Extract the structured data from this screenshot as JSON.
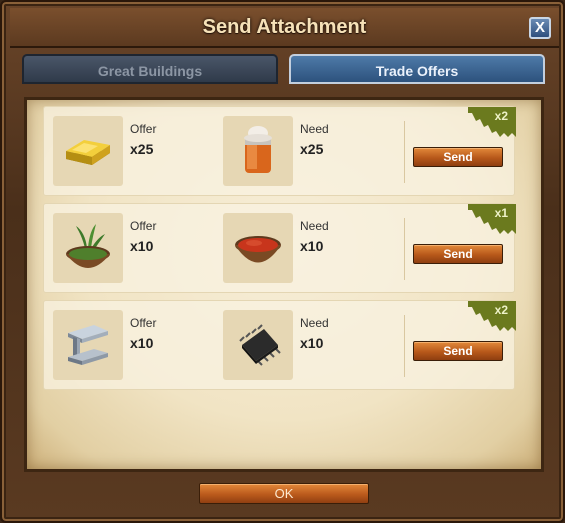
{
  "window": {
    "title": "Send Attachment",
    "close_label": "X"
  },
  "tabs": [
    {
      "label": "Great Buildings",
      "active": false
    },
    {
      "label": "Trade Offers",
      "active": true
    }
  ],
  "offers": [
    {
      "offer_label": "Offer",
      "offer_amount": "x25",
      "offer_icon": "gold-bar-icon",
      "need_label": "Need",
      "need_amount": "x25",
      "need_icon": "jar-preserves-icon",
      "badge": "x2",
      "send_label": "Send"
    },
    {
      "offer_label": "Offer",
      "offer_amount": "x10",
      "offer_icon": "herb-bowl-icon",
      "need_label": "Need",
      "need_amount": "x10",
      "need_icon": "dye-bowl-icon",
      "badge": "x1",
      "send_label": "Send"
    },
    {
      "offer_label": "Offer",
      "offer_amount": "x10",
      "offer_icon": "steel-beam-icon",
      "need_label": "Need",
      "need_amount": "x10",
      "need_icon": "microchip-icon",
      "badge": "x2",
      "send_label": "Send"
    }
  ],
  "footer": {
    "ok_label": "OK"
  },
  "colors": {
    "accent_send": "#b7581a",
    "tab_active": "#2d527d",
    "badge": "#6b7a1e"
  }
}
